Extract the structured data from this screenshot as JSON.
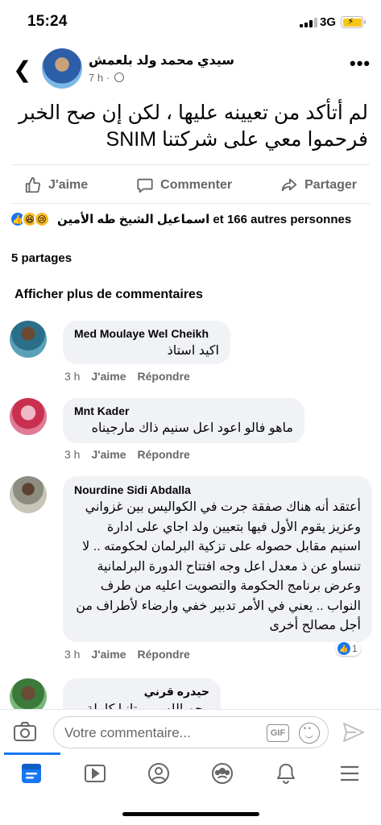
{
  "status_bar": {
    "time": "15:24",
    "network": "3G"
  },
  "post": {
    "author": "سيدي محمد ولد بلعمش",
    "time": "7 h",
    "text_lines": [
      "لم أتأكد من تعيينه عليها ، لكن إن صح الخبر",
      "فرحموا معي على شركتنا SNIM"
    ]
  },
  "actions": {
    "like": "J'aime",
    "comment": "Commenter",
    "share": "Partager"
  },
  "reactions": {
    "text": "اسماعيل الشيخ طه الأمين et 166 autres personnes",
    "icons": [
      "like",
      "haha",
      "sad"
    ]
  },
  "shares": "5 partages",
  "more_comments": "Afficher plus de commentaires",
  "comments": [
    {
      "name": "Med Moulaye Wel Cheikh",
      "text": "اكيد استاذ",
      "time": "3 h",
      "like": "J'aime",
      "reply": "Répondre"
    },
    {
      "name": "Mnt Kader",
      "text": "ماهو فالو اعود اعل سنيم ذاك مارجيناه",
      "time": "3 h",
      "like": "J'aime",
      "reply": "Répondre"
    },
    {
      "name": "Nourdine Sidi Abdalla",
      "text": "أعتقد أنه هناك صفقة جرت في الكواليس بين غزواني وعزيز يقوم الأول فيها بتعيين ولد اجاي على ادارة اسنيم مقابل حصوله على تزكية البرلمان لحكومته .. لا تنساو عن ذ معدل اعل وجه افتتاح الدورة البرلمانية وعرض برنامج الحكومة والتصويت اعليه من طرف النواب .. يعني في الأمر تدبير خفي وارضاء لأطراف من أجل مصالح أخرى",
      "time": "3 h",
      "like": "J'aime",
      "reply": "Répondre",
      "reaction_count": "1"
    },
    {
      "name": "حيدره قرني",
      "text": "رحم الله موريتانيا كاملة"
    }
  ],
  "composer": {
    "placeholder": "Votre commentaire...",
    "gif_label": "GIF"
  },
  "tabbar": [
    "home-icon",
    "video-icon",
    "profile-icon",
    "groups-icon",
    "bell-icon",
    "menu-icon"
  ],
  "colors": {
    "accent": "#1877f2",
    "secondary_text": "#65676b",
    "bubble": "#f0f2f5"
  }
}
